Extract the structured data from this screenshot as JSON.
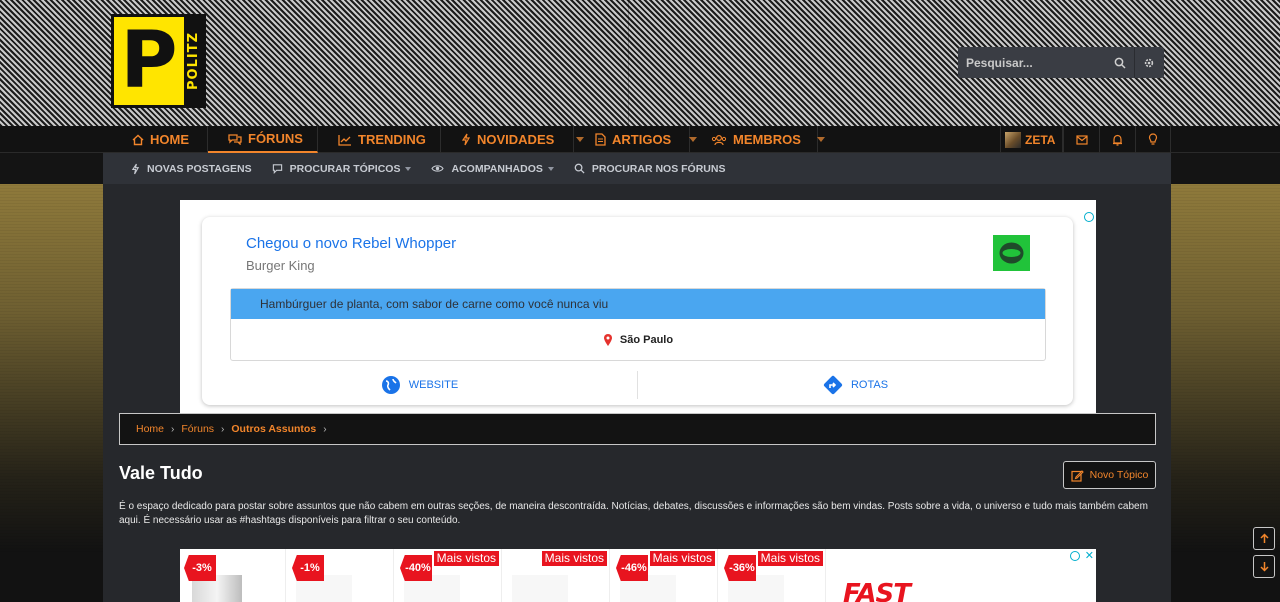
{
  "brand": {
    "logo_letter": "P",
    "logo_side": "POLITZ",
    "accent": "#f2852b",
    "logo_color": "#ffe500"
  },
  "search": {
    "placeholder": "Pesquisar..."
  },
  "nav": {
    "items": [
      {
        "label": "Home",
        "icon": "home-icon"
      },
      {
        "label": "Fóruns",
        "icon": "comments-icon",
        "active": true
      },
      {
        "label": "Trending",
        "icon": "chart-line-icon"
      },
      {
        "label": "Novidades",
        "icon": "bolt-icon",
        "dropdown": true
      },
      {
        "label": "Artigos",
        "icon": "document-icon",
        "dropdown": true
      },
      {
        "label": "Membros",
        "icon": "users-icon",
        "dropdown": true
      }
    ],
    "user": {
      "name": "ZETA"
    }
  },
  "subnav": {
    "items": [
      {
        "label": "Novas postagens",
        "icon": "bolt-icon"
      },
      {
        "label": "Procurar tópicos",
        "icon": "comment-icon",
        "dropdown": true
      },
      {
        "label": "Acompanhados",
        "icon": "eye-icon",
        "dropdown": true
      },
      {
        "label": "Procurar nos fóruns",
        "icon": "search-icon"
      }
    ]
  },
  "ad1": {
    "title": "Chegou o novo Rebel Whopper",
    "advertiser": "Burger King",
    "description": "Hambúrguer de planta, com sabor de carne como você nunca viu",
    "location": "São Paulo",
    "actions": [
      "Website",
      "Rotas"
    ]
  },
  "breadcrumb": [
    "Home",
    "Fóruns",
    "Outros Assuntos"
  ],
  "page": {
    "title": "Vale Tudo",
    "new_topic": "Novo Tópico",
    "description": "É o espaço dedicado para postar sobre assuntos que não cabem em outras seções, de maneira descontraída. Notícias, debates, discussões e informações são bem vindas. Posts sobre a vida, o universo e tudo mais também cabem aqui. É necessário usar as #hashtags disponíveis para filtrar o seu conteúdo."
  },
  "ad2": {
    "products": [
      {
        "discount": "-3%",
        "label": ""
      },
      {
        "discount": "-1%",
        "label": ""
      },
      {
        "discount": "-40%",
        "label": "Mais vistos"
      },
      {
        "discount": "",
        "label": "Mais vistos"
      },
      {
        "discount": "-46%",
        "label": "Mais vistos"
      },
      {
        "discount": "-36%",
        "label": "Mais vistos"
      }
    ],
    "brand_text": "FAST",
    "close": "✕"
  }
}
